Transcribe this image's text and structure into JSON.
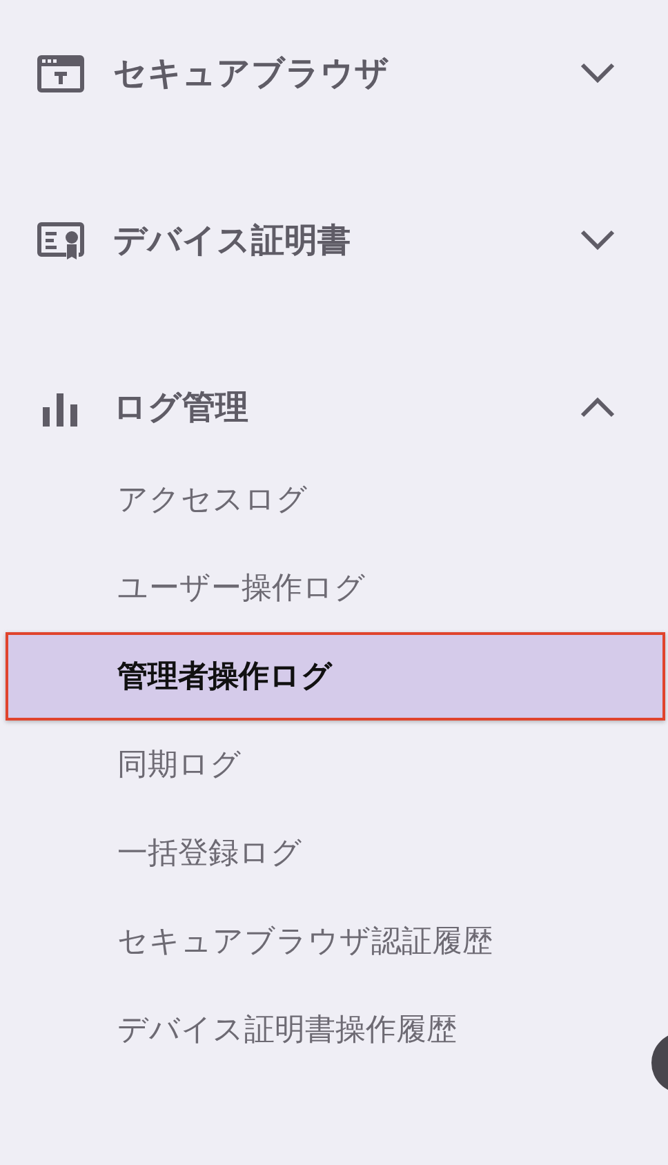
{
  "sidebar": {
    "sections": [
      {
        "label": "セキュアブラウザ",
        "expanded": false
      },
      {
        "label": "デバイス証明書",
        "expanded": false
      },
      {
        "label": "ログ管理",
        "expanded": true,
        "items": [
          {
            "label": "アクセスログ",
            "selected": false
          },
          {
            "label": "ユーザー操作ログ",
            "selected": false
          },
          {
            "label": "管理者操作ログ",
            "selected": true
          },
          {
            "label": "同期ログ",
            "selected": false
          },
          {
            "label": "一括登録ログ",
            "selected": false
          },
          {
            "label": "セキュアブラウザ認証履歴",
            "selected": false
          },
          {
            "label": "デバイス証明書操作履歴",
            "selected": false
          }
        ]
      }
    ]
  }
}
